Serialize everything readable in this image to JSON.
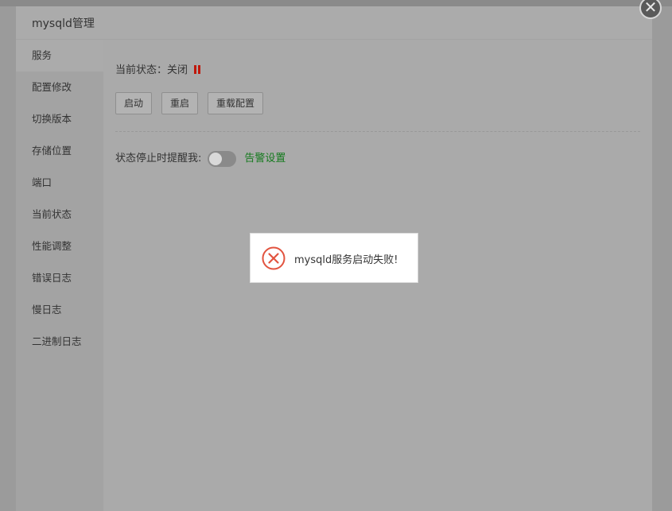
{
  "modal": {
    "title": "mysqld管理",
    "close_label": "✕"
  },
  "sidebar": {
    "items": [
      {
        "label": "服务",
        "active": true
      },
      {
        "label": "配置修改"
      },
      {
        "label": "切换版本"
      },
      {
        "label": "存储位置"
      },
      {
        "label": "端口"
      },
      {
        "label": "当前状态"
      },
      {
        "label": "性能调整"
      },
      {
        "label": "错误日志"
      },
      {
        "label": "慢日志"
      },
      {
        "label": "二进制日志"
      }
    ]
  },
  "service": {
    "status_label": "当前状态：",
    "status_value": "关闭",
    "status_icon": "pause-icon",
    "status_color": "#c0180b",
    "buttons": {
      "start": "启动",
      "restart": "重启",
      "reload": "重载配置"
    },
    "alert_label": "状态停止时提醒我:",
    "alert_enabled": false,
    "alert_link": "告警设置",
    "alert_link_color": "#157a1e"
  },
  "toast": {
    "icon": "error-circle-icon",
    "icon_color": "#e2533f",
    "message": "mysqld服务启动失败!"
  }
}
